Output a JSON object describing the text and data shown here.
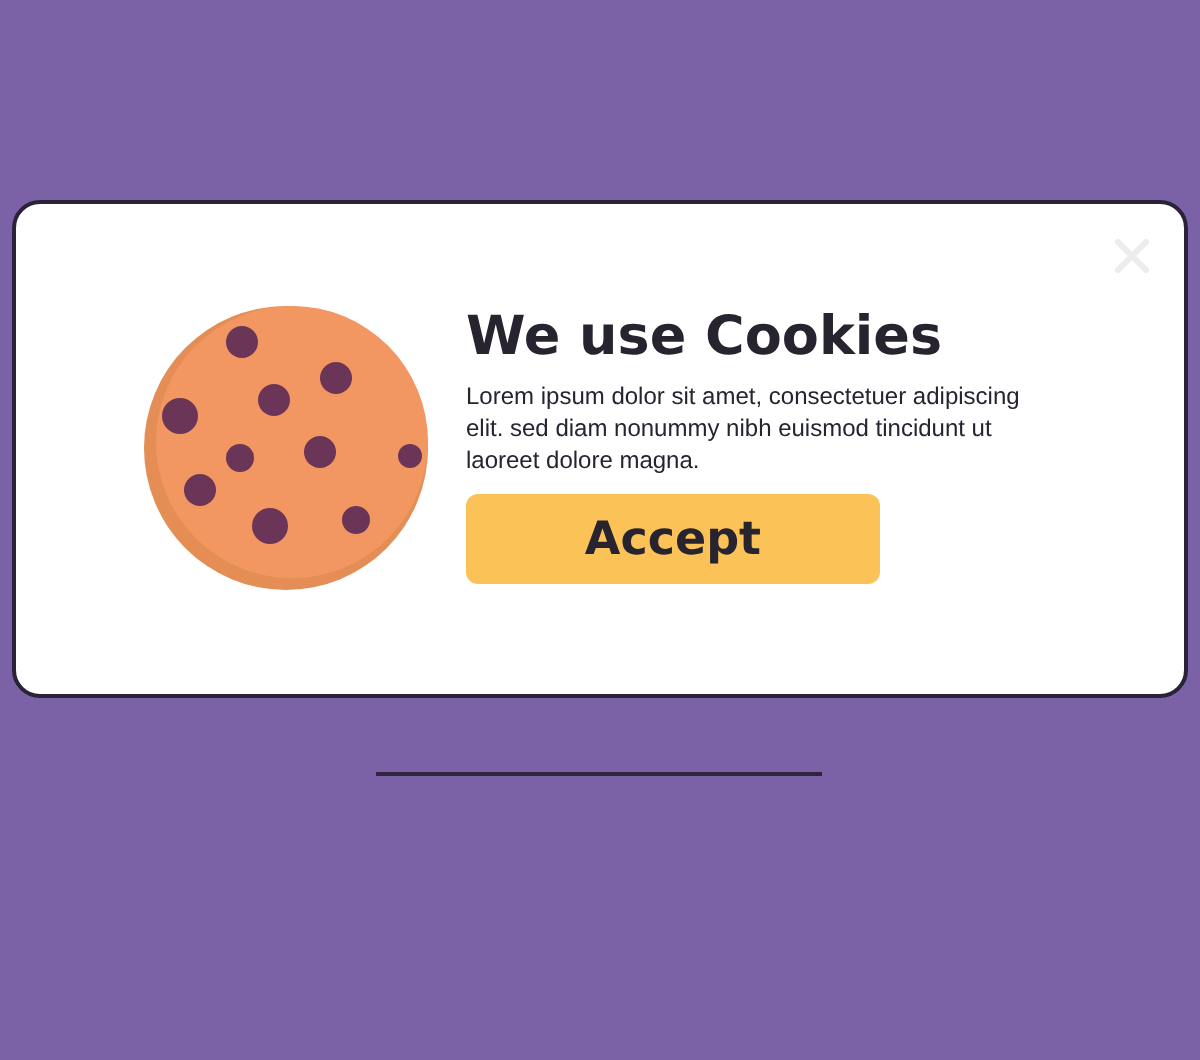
{
  "dialog": {
    "title": "We use Cookies",
    "message": "Lorem ipsum dolor sit amet, consectetuer adipiscing elit. sed diam nonummy nibh euismod tincidunt ut laoreet dolore magna.",
    "button": "Accept"
  }
}
